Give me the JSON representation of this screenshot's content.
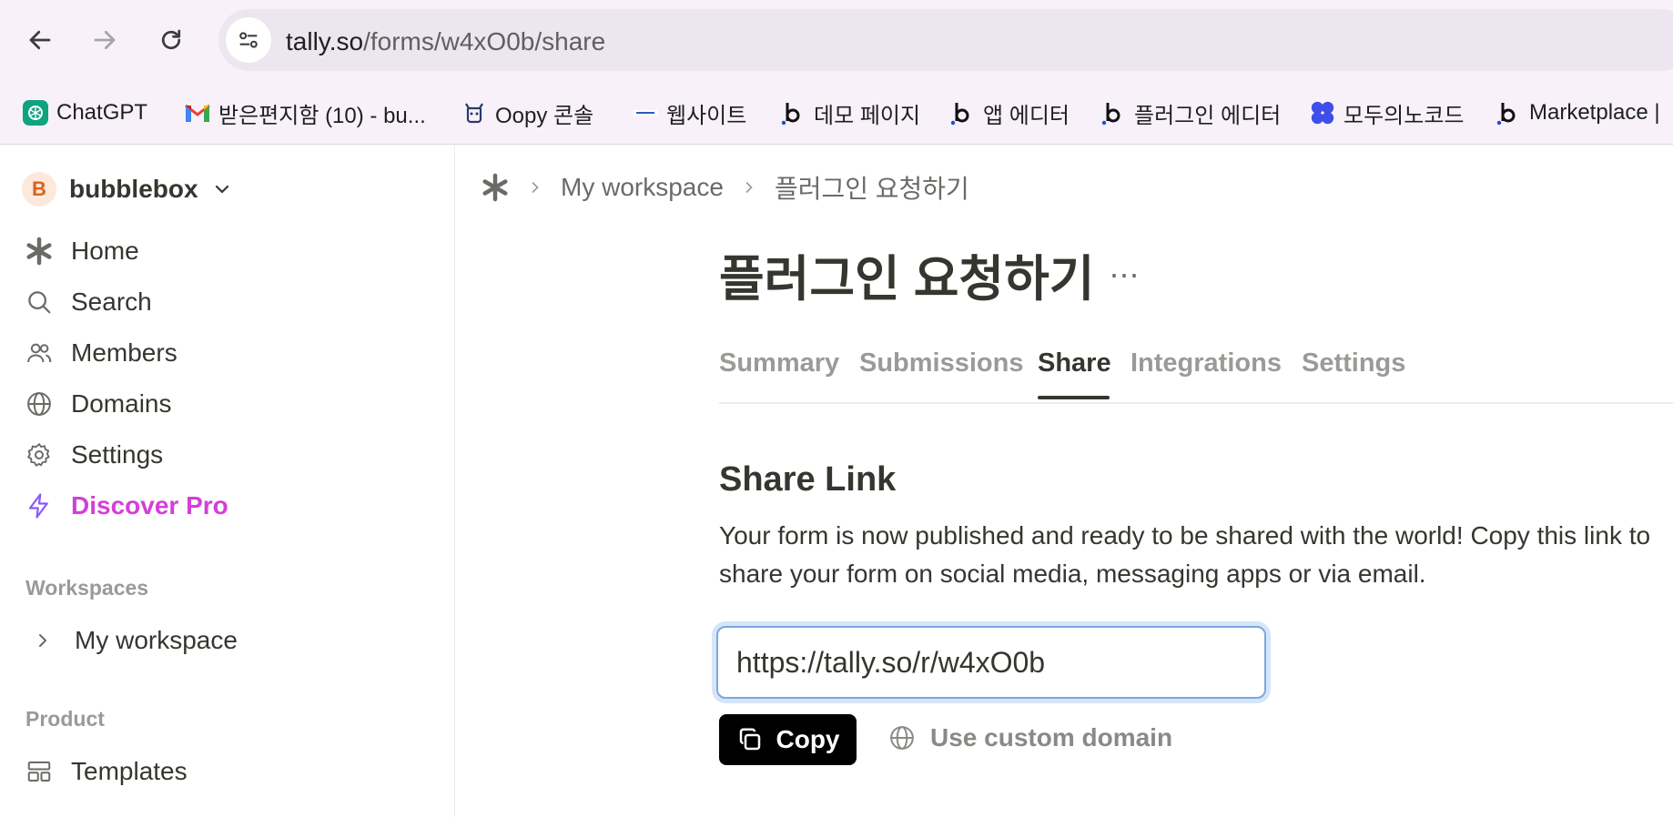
{
  "browser": {
    "url_host": "tally.so",
    "url_path": "/forms/w4xO0b/share",
    "bookmarks": [
      {
        "label": "ChatGPT",
        "icon": "chatgpt-icon"
      },
      {
        "label": "받은편지함 (10) - bu...",
        "icon": "gmail-icon"
      },
      {
        "label": "Oopy 콘솔",
        "icon": "oopy-icon"
      },
      {
        "label": "웹사이트",
        "icon": "website-icon"
      },
      {
        "label": "데모 페이지",
        "icon": "bubble-icon"
      },
      {
        "label": "앱 에디터",
        "icon": "bubble-icon"
      },
      {
        "label": "플러그인 에디터",
        "icon": "bubble-icon"
      },
      {
        "label": "모두의노코드",
        "icon": "modunocode-icon"
      },
      {
        "label": "Marketplace |",
        "icon": "bubble-icon"
      }
    ]
  },
  "sidebar": {
    "workspace_initial": "B",
    "workspace_name": "bubblebox",
    "nav": [
      {
        "label": "Home",
        "icon": "asterisk-icon"
      },
      {
        "label": "Search",
        "icon": "search-icon"
      },
      {
        "label": "Members",
        "icon": "members-icon"
      },
      {
        "label": "Domains",
        "icon": "globe-icon"
      },
      {
        "label": "Settings",
        "icon": "gear-icon"
      },
      {
        "label": "Discover Pro",
        "icon": "lightning-icon"
      }
    ],
    "workspaces_heading": "Workspaces",
    "workspace_item": "My workspace",
    "product_heading": "Product",
    "product_items": [
      {
        "label": "Templates",
        "icon": "templates-icon"
      }
    ]
  },
  "main": {
    "breadcrumb": [
      "My workspace",
      "플러그인 요청하기"
    ],
    "title": "플러그인 요청하기",
    "more": "···",
    "tabs": [
      "Summary",
      "Submissions",
      "Share",
      "Integrations",
      "Settings"
    ],
    "active_tab": "Share",
    "share": {
      "heading": "Share Link",
      "description": "Your form is now published and ready to be shared with the world! Copy this link to share your form on social media, messaging apps or via email.",
      "link": "https://tally.so/r/w4xO0b",
      "copy_label": "Copy",
      "custom_domain_label": "Use custom domain"
    }
  },
  "colors": {
    "pro_accent": "#d43fd8",
    "focus_ring": "#7aa7e0",
    "avatar_bg": "#fde8dc"
  }
}
